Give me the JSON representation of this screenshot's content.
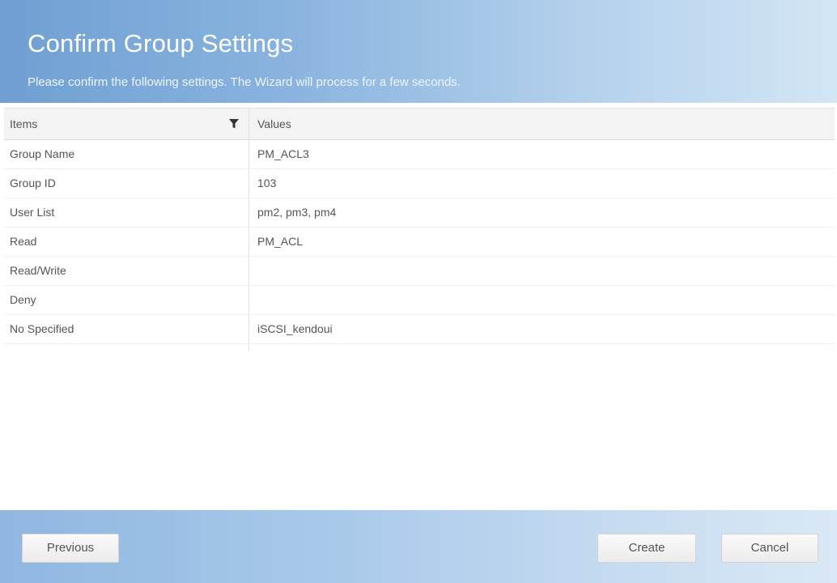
{
  "header": {
    "title": "Confirm Group Settings",
    "subtitle": "Please confirm the following settings. The Wizard will process for a few seconds."
  },
  "grid": {
    "columns": [
      "Items",
      "Values"
    ],
    "rows": [
      {
        "item": "Group Name",
        "value": "PM_ACL3"
      },
      {
        "item": "Group ID",
        "value": "103"
      },
      {
        "item": "User List",
        "value": "pm2, pm3, pm4"
      },
      {
        "item": "Read",
        "value": "PM_ACL"
      },
      {
        "item": "Read/Write",
        "value": ""
      },
      {
        "item": "Deny",
        "value": ""
      },
      {
        "item": "No Specified",
        "value": "iSCSI_kendoui"
      }
    ],
    "filter_icon": "filter-icon"
  },
  "footer": {
    "previous_label": "Previous",
    "create_label": "Create",
    "cancel_label": "Cancel"
  },
  "colors": {
    "header_gradient_start": "#6f9fd3",
    "header_gradient_end": "#d3e6f5",
    "footer_gradient_start": "#8fb7e0",
    "footer_gradient_end": "#dbe9f6"
  }
}
